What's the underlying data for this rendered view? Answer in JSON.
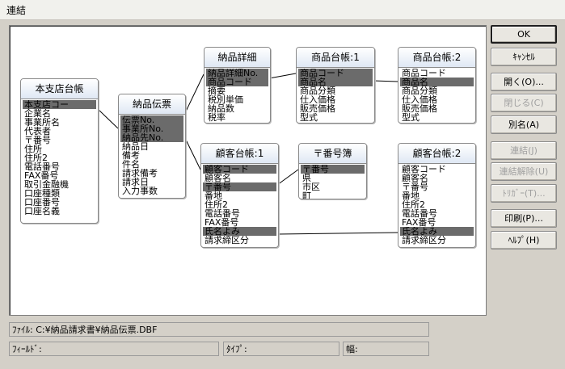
{
  "window": {
    "title": "連結"
  },
  "tables": [
    {
      "title": "本支店台帳",
      "fields": [
        {
          "text": "本支店コー",
          "sel": true
        },
        {
          "text": "企業名"
        },
        {
          "text": "事業所名"
        },
        {
          "text": "代表者"
        },
        {
          "text": "〒番号"
        },
        {
          "text": "住所"
        },
        {
          "text": "住所2"
        },
        {
          "text": "電話番号"
        },
        {
          "text": "FAX番号"
        },
        {
          "text": "取引金融機"
        },
        {
          "text": "口座種類"
        },
        {
          "text": "口座番号"
        },
        {
          "text": "口座名義"
        }
      ]
    },
    {
      "title": "納品伝票",
      "fields": [
        {
          "text": "伝票No.",
          "sel": true
        },
        {
          "text": "事業所No.",
          "sel": true
        },
        {
          "text": "納品先No.",
          "sel": true
        },
        {
          "text": "納品日"
        },
        {
          "text": "備考"
        },
        {
          "text": "件名"
        },
        {
          "text": "請求備考"
        },
        {
          "text": "請求日"
        },
        {
          "text": "入力事数"
        }
      ]
    },
    {
      "title": "納品詳細",
      "fields": [
        {
          "text": "納品詳細No.",
          "sel": true
        },
        {
          "text": "商品コード",
          "sel": true
        },
        {
          "text": "摘要"
        },
        {
          "text": "税別単価"
        },
        {
          "text": "納品数"
        },
        {
          "text": "税率"
        }
      ]
    },
    {
      "title": "商品台帳:1",
      "fields": [
        {
          "text": "商品コード",
          "sel": true
        },
        {
          "text": "商品名",
          "sel": true
        },
        {
          "text": "商品分類"
        },
        {
          "text": "仕入価格"
        },
        {
          "text": "販売価格"
        },
        {
          "text": "型式"
        }
      ]
    },
    {
      "title": "商品台帳:2",
      "fields": [
        {
          "text": "商品コード"
        },
        {
          "text": "商品名",
          "sel": true
        },
        {
          "text": "商品分類"
        },
        {
          "text": "仕入価格"
        },
        {
          "text": "販売価格"
        },
        {
          "text": "型式"
        }
      ]
    },
    {
      "title": "顧客台帳:1",
      "fields": [
        {
          "text": "顧客コード",
          "sel": true
        },
        {
          "text": "顧客名"
        },
        {
          "text": "〒番号",
          "sel": true
        },
        {
          "text": "番地"
        },
        {
          "text": "住所2"
        },
        {
          "text": "電話番号"
        },
        {
          "text": "FAX番号"
        },
        {
          "text": "氏名よみ",
          "sel": true
        },
        {
          "text": "請求締区分"
        }
      ]
    },
    {
      "title": "〒番号簿",
      "fields": [
        {
          "text": "〒番号",
          "sel": true
        },
        {
          "text": "県"
        },
        {
          "text": "市区"
        },
        {
          "text": "町"
        }
      ]
    },
    {
      "title": "顧客台帳:2",
      "fields": [
        {
          "text": "顧客コード"
        },
        {
          "text": "顧客名"
        },
        {
          "text": "〒番号"
        },
        {
          "text": "番地"
        },
        {
          "text": "住所2"
        },
        {
          "text": "電話番号"
        },
        {
          "text": "FAX番号"
        },
        {
          "text": "氏名よみ",
          "sel": true
        },
        {
          "text": "請求締区分"
        }
      ]
    }
  ],
  "buttons": {
    "ok": "OK",
    "cancel": "ｷｬﾝｾﾙ",
    "open": "開く(O)...",
    "close": "閉じる(C)",
    "alias": "別名(A)",
    "link": "連結(J)",
    "unlink": "連結解除(U)",
    "trigger": "ﾄﾘｶﾞｰ(T)...",
    "print": "印刷(P)...",
    "help": "ﾍﾙﾌﾟ(H)"
  },
  "status": {
    "file": "ﾌｧｲﾙ: C:¥納品請求書¥納品伝票.DBF",
    "field": "ﾌｨｰﾙﾄﾞ:",
    "type": "ﾀｲﾌﾟ:",
    "width": "幅:"
  }
}
